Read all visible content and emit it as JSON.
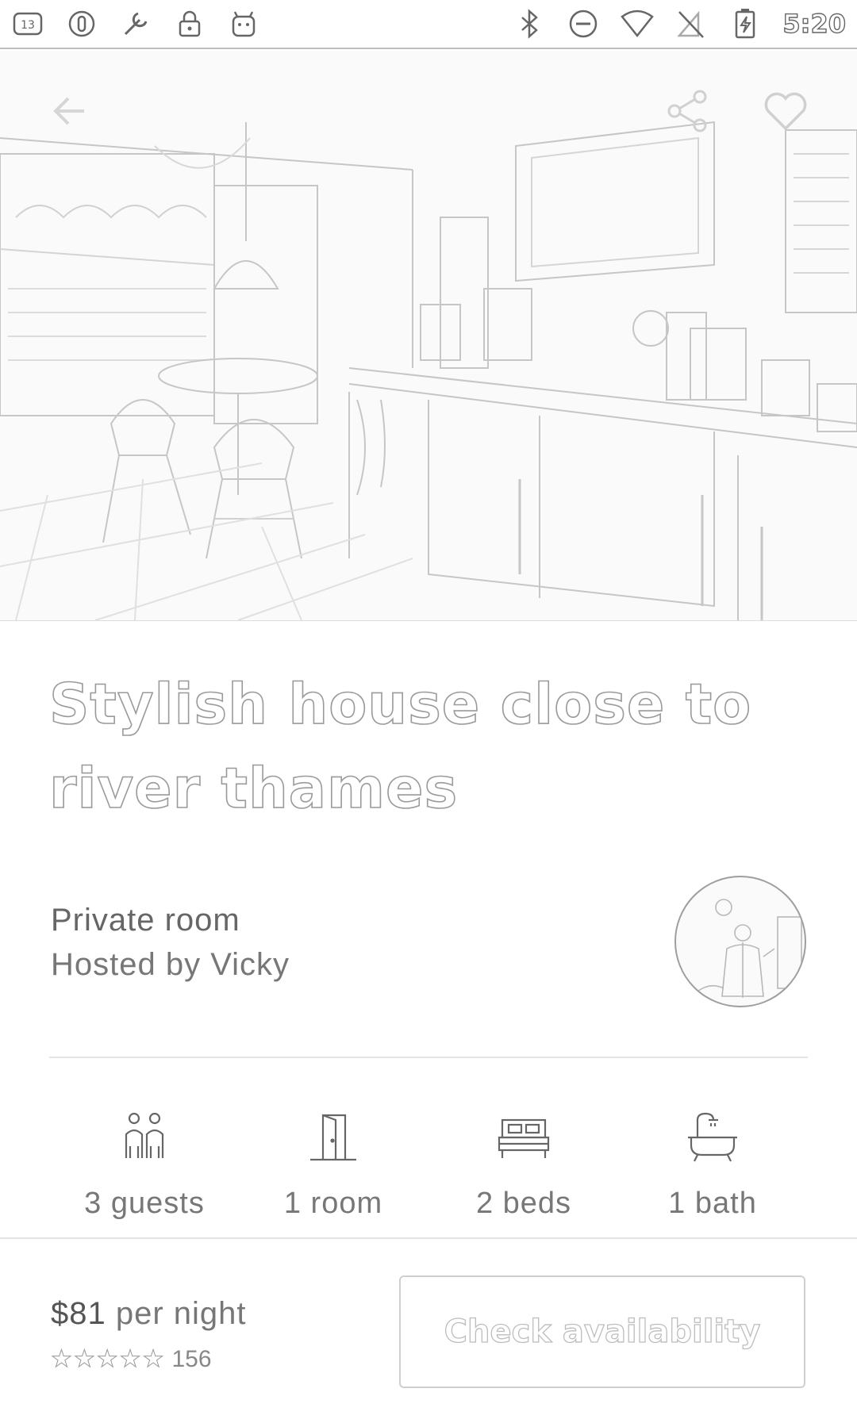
{
  "status_bar": {
    "time": "5:20",
    "left_icons": [
      "notification-count-icon",
      "circle-icon",
      "wrench-icon",
      "lock-icon",
      "android-icon"
    ],
    "right_icons": [
      "bluetooth-icon",
      "do-not-disturb-icon",
      "wifi-icon",
      "no-sim-icon",
      "battery-charging-icon"
    ],
    "notification_count": "13"
  },
  "listing": {
    "title": "Stylish house close to river thames",
    "room_type": "Private room",
    "host_line": "Hosted by Vicky"
  },
  "amenities": [
    {
      "icon": "guests-icon",
      "label": "3 guests"
    },
    {
      "icon": "door-icon",
      "label": "1 room"
    },
    {
      "icon": "bed-icon",
      "label": "2 beds"
    },
    {
      "icon": "bath-icon",
      "label": "1 bath"
    }
  ],
  "footer": {
    "price_amount": "$81",
    "price_suffix": " per night",
    "stars": "★★★★★",
    "review_count": "156",
    "check_button_label": "Check availability"
  },
  "colors": {
    "background": "#ffffff",
    "text": "#777777",
    "outline": "#9a9a9a"
  }
}
